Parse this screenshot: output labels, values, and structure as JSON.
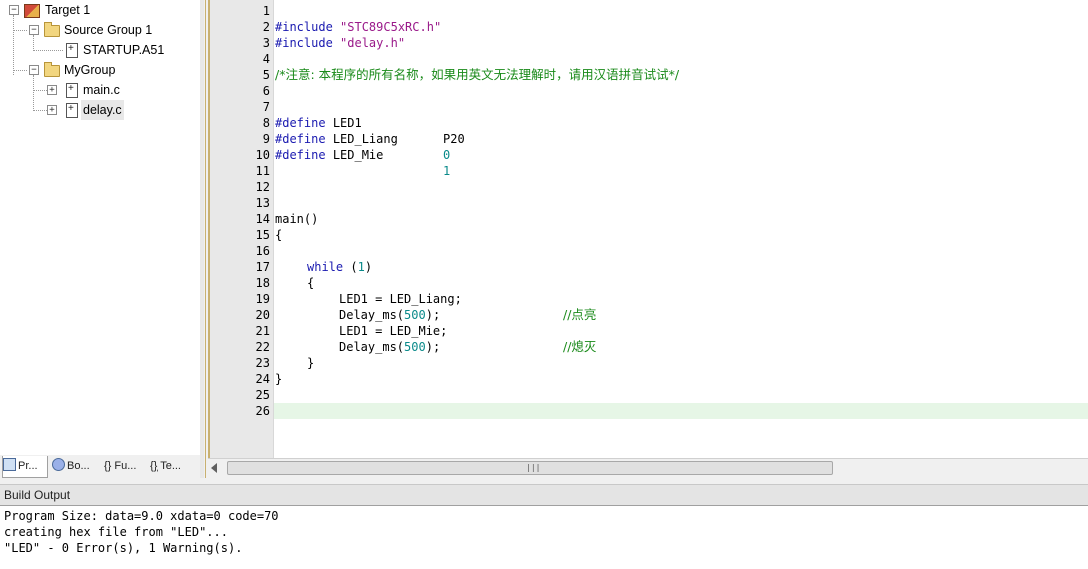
{
  "project_tree": {
    "target": "Target 1",
    "source_group": "Source Group 1",
    "startup_file": "STARTUP.A51",
    "my_group": "MyGroup",
    "files": [
      "main.c",
      "delay.c"
    ]
  },
  "project_tabs": [
    "Pr...",
    "Bo...",
    "{} Fu...",
    "{}̩ Te..."
  ],
  "editor": {
    "line_numbers": [
      "1",
      "2",
      "3",
      "4",
      "5",
      "6",
      "7",
      "8",
      "9",
      "10",
      "11",
      "12",
      "13",
      "14",
      "15",
      "16",
      "17",
      "18",
      "19",
      "20",
      "21",
      "22",
      "23",
      "24",
      "25",
      "26"
    ],
    "current_line": 26
  },
  "code": {
    "l1_pp": "#include",
    "l1_str": "\"STC89C5xRC.h\"",
    "l2_pp": "#include",
    "l2_str": "\"delay.h\"",
    "l4_comment": "/*注意: 本程序的所有名称，如果用英文无法理解时，请用汉语拼音试试*/",
    "l7_pp": "#define",
    "l7_name": "LED1",
    "l7_val": "P20",
    "l8_pp": "#define",
    "l8_name": "LED_Liang",
    "l8_val": "0",
    "l9_pp": "#define",
    "l9_name": "LED_Mie",
    "l9_val": "1",
    "l13": "main()",
    "l14": "{",
    "l16_kw": "while",
    "l16_open": "(",
    "l16_num": "1",
    "l16_close": ")",
    "l17": "{",
    "l18_code": "LED1 = LED_Liang;",
    "l18_comment": "//点亮",
    "l19_code": "Delay_ms(",
    "l19_num": "500",
    "l19_end": ");",
    "l20_code": "LED1 = LED_Mie;",
    "l20_comment": "//熄灭",
    "l21_code": "Delay_ms(",
    "l21_num": "500",
    "l21_end": ");",
    "l22": "}",
    "l23": "}"
  },
  "scrollbar": {
    "grip": "|||"
  },
  "build": {
    "header": "Build Output",
    "lines": [
      "Program Size: data=9.0 xdata=0 code=70",
      "creating hex file from \"LED\"...",
      "\"LED\" - 0 Error(s), 1 Warning(s)."
    ]
  },
  "colors": {
    "preprocessor": "#1a1ab0",
    "string": "#9a1a8a",
    "number": "#0a8a8a",
    "comment": "#1a8a1a",
    "current_line_bg": "#e6f6e6"
  }
}
